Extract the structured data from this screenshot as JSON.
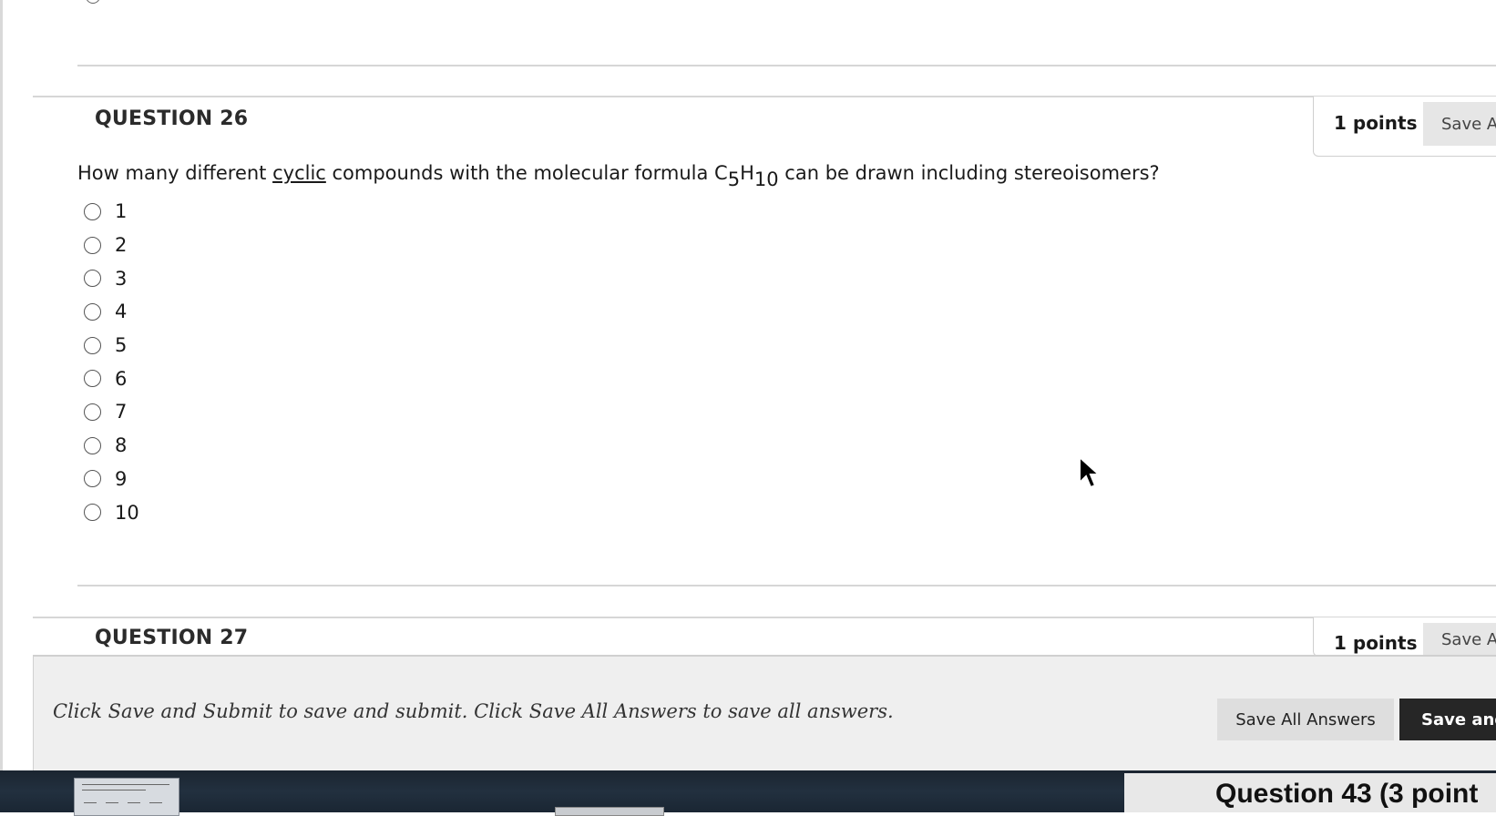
{
  "question26": {
    "title": "QUESTION 26",
    "points": "1 points",
    "save_answer_label": "Save A",
    "text_before": "How many different ",
    "text_underlined": "cyclic",
    "text_middle": " compounds with the molecular formula C",
    "sub_c": "5",
    "text_h": "H",
    "sub_h": "10",
    "text_after": " can be drawn including stereoisomers?",
    "choices": [
      "1",
      "2",
      "3",
      "4",
      "5",
      "6",
      "7",
      "8",
      "9",
      "10"
    ]
  },
  "question27": {
    "title": "QUESTION 27",
    "points": "1 points",
    "save_answer_label": "Save A"
  },
  "footer": {
    "instructions": "Click Save and Submit to save and submit. Click Save All Answers to save all answers.",
    "save_all_label": "Save All Answers",
    "save_submit_label": "Save and"
  },
  "taskbar": {
    "window_title": "Question 43 (3 point"
  }
}
